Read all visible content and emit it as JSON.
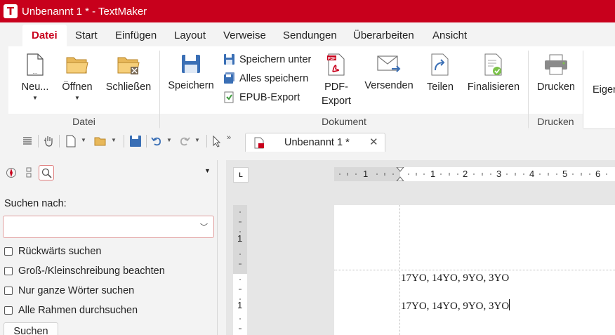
{
  "app": {
    "title": "Unbenannt 1 * - TextMaker",
    "logo": "T",
    "accent": "#c8001c"
  },
  "menu": {
    "tabs": [
      "Datei",
      "Start",
      "Einfügen",
      "Layout",
      "Verweise",
      "Sendungen",
      "Überarbeiten",
      "Ansicht"
    ],
    "active": "Datei"
  },
  "ribbon": {
    "datei": {
      "label": "Datei",
      "new": "Neu...",
      "open": "Öffnen",
      "close": "Schließen"
    },
    "dokument": {
      "label": "Dokument",
      "save": "Speichern",
      "save_as": "Speichern unter",
      "save_all": "Alles speichern",
      "epub": "EPUB-Export",
      "pdf_line1": "PDF-",
      "pdf_line2": "Export",
      "send": "Versenden",
      "share": "Teilen",
      "finalize": "Finalisieren"
    },
    "drucken": {
      "label": "Drucken",
      "print": "Drucken"
    },
    "more": "Eigen"
  },
  "document_tab": {
    "label": "Unbenannt 1 *",
    "close": "✕"
  },
  "panel": {
    "menu_caret": "▼",
    "search_label": "Suchen nach:",
    "search_value": "",
    "options": [
      "Rückwärts suchen",
      "Groß-/Kleinschreibung beachten",
      "Nur ganze Wörter suchen",
      "Alle Rahmen durchsuchen"
    ],
    "search_button": "Suchen"
  },
  "ruler": {
    "corner": "L",
    "h_numbers": [
      "1",
      "1",
      "2",
      "3",
      "4",
      "5",
      "6"
    ],
    "v_numbers": [
      "1",
      "1"
    ]
  },
  "document": {
    "lines": [
      "17YO, 14YO, 9YO, 3YO",
      "17YO, 14YO, 9YO, 3YO"
    ]
  }
}
